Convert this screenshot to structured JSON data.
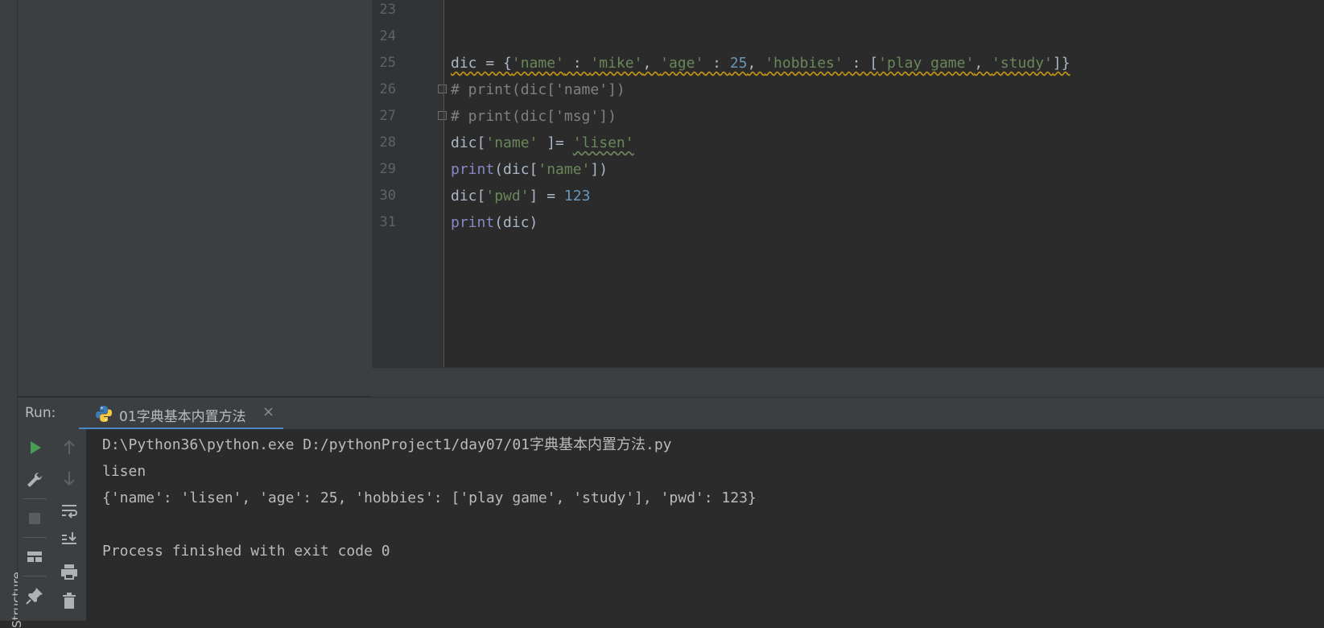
{
  "sidebar": {
    "structure_tab": "Structure"
  },
  "editor": {
    "line_numbers": [
      "23",
      "24",
      "25",
      "26",
      "27",
      "28",
      "29",
      "30",
      "31"
    ],
    "lines": {
      "l25": {
        "a": "dic = {",
        "b": "'name'",
        "c": " : ",
        "d": "'mike'",
        "e": ", ",
        "f": "'age'",
        "g": " : ",
        "h": "25",
        "i": ", ",
        "j": "'hobbies'",
        "k": " : [",
        "l": "'play game'",
        "m": ", ",
        "n": "'study'",
        "o": "]}"
      },
      "l26": "# print(dic['name'])",
      "l27": "# print(dic['msg'])",
      "l28": {
        "a": "dic[",
        "b": "'name' ",
        "c": "]= ",
        "d": "'lisen'"
      },
      "l29": {
        "a": "print",
        "b": "(dic[",
        "c": "'name'",
        "d": "])"
      },
      "l30": {
        "a": "dic[",
        "b": "'pwd'",
        "c": "] = ",
        "d": "123"
      },
      "l31": {
        "a": "print",
        "b": "(dic)"
      }
    }
  },
  "run_panel": {
    "label": "Run:",
    "tab_title": "01字典基本内置方法",
    "tab_close": "×",
    "output": [
      "D:\\Python36\\python.exe D:/pythonProject1/day07/01字典基本内置方法.py",
      "lisen",
      "{'name': 'lisen', 'age': 25, 'hobbies': ['play game', 'study'], 'pwd': 123}",
      "",
      "Process finished with exit code 0"
    ]
  },
  "colors": {
    "accent": "#4a88c7",
    "run_green": "#499c54",
    "string": "#6a8759",
    "number": "#6897bb",
    "builtin": "#8888c6"
  }
}
